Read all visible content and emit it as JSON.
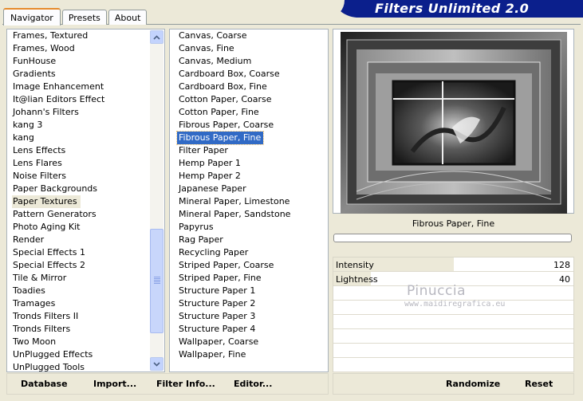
{
  "tabs": [
    "Navigator",
    "Presets",
    "About"
  ],
  "title": "Filters Unlimited 2.0",
  "categories": [
    "Frames, Textured",
    "Frames, Wood",
    "FunHouse",
    "Gradients",
    "Image Enhancement",
    "It@lian Editors Effect",
    "Johann's Filters",
    "kang 3",
    "kang",
    "Lens Effects",
    "Lens Flares",
    "Noise Filters",
    "Paper Backgrounds",
    "Paper Textures",
    "Pattern Generators",
    "Photo Aging Kit",
    "Render",
    "Special Effects 1",
    "Special Effects 2",
    "Tile & Mirror",
    "Toadies",
    "Tramages",
    "Tronds Filters II",
    "Tronds Filters",
    "Two Moon",
    "UnPlugged Effects",
    "UnPlugged Tools"
  ],
  "selected_category": "Paper Textures",
  "filters": [
    "Canvas, Coarse",
    "Canvas, Fine",
    "Canvas, Medium",
    "Cardboard Box, Coarse",
    "Cardboard Box, Fine",
    "Cotton Paper, Coarse",
    "Cotton Paper, Fine",
    "Fibrous Paper, Coarse",
    "Fibrous Paper, Fine",
    "Filter Paper",
    "Hemp Paper 1",
    "Hemp Paper 2",
    "Japanese Paper",
    "Mineral Paper, Limestone",
    "Mineral Paper, Sandstone",
    "Papyrus",
    "Rag Paper",
    "Recycling Paper",
    "Striped Paper, Coarse",
    "Striped Paper, Fine",
    "Structure Paper 1",
    "Structure Paper 2",
    "Structure Paper 3",
    "Structure Paper 4",
    "Wallpaper, Coarse",
    "Wallpaper, Fine"
  ],
  "selected_filter": "Fibrous Paper, Fine",
  "preview_filter_name": "Fibrous Paper, Fine",
  "params": [
    {
      "label": "Intensity",
      "value": "128",
      "level": 0.502
    },
    {
      "label": "Lightness",
      "value": "40",
      "level": 0.157
    }
  ],
  "watermark": {
    "line1": "Pinuccia",
    "line2": "www.maidiregrafica.eu"
  },
  "buttons": {
    "database": "Database",
    "import": "Import...",
    "filter_info": "Filter Info...",
    "editor": "Editor...",
    "randomize": "Randomize",
    "reset": "Reset"
  },
  "colors": {
    "title_bg": "#0b1f8c",
    "selection": "#316ac5",
    "tab_accent": "#e68b2c"
  }
}
